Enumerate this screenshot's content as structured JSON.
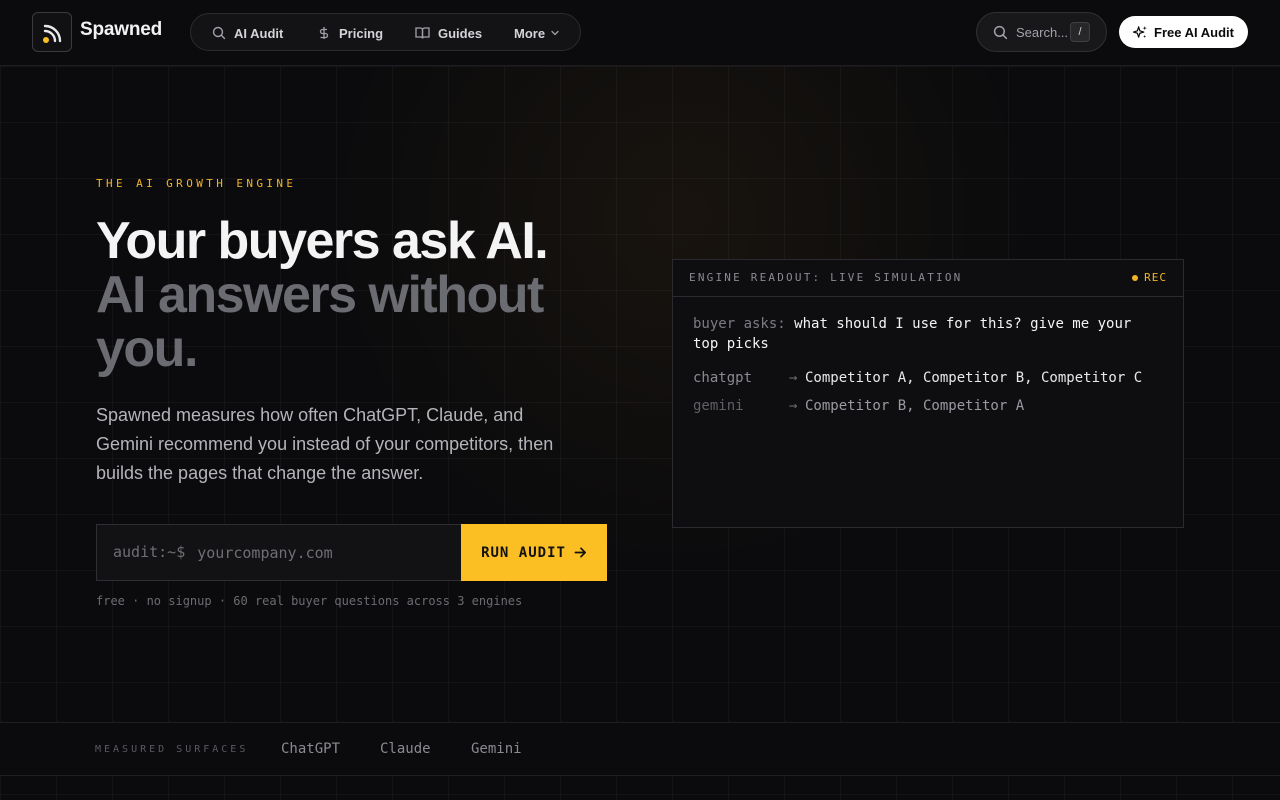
{
  "nav": {
    "brand": "Spawned",
    "items": [
      {
        "label": "AI Audit",
        "icon": "search-icon"
      },
      {
        "label": "Pricing",
        "icon": "dollar-icon"
      },
      {
        "label": "Guides",
        "icon": "book-icon"
      },
      {
        "label": "More",
        "icon": "chevron-down-icon"
      }
    ],
    "search_label": "Search...",
    "search_shortcut": "/",
    "cta_label": "Free AI Audit"
  },
  "hero": {
    "eyebrow": "THE AI GROWTH ENGINE",
    "headline_line1": "Your buyers ask AI.",
    "headline_line2": "AI answers without you.",
    "subcopy": "Spawned measures how often ChatGPT, Claude, and Gemini recommend you instead of your competitors, then builds the pages that change the answer.",
    "audit_prefix": "audit:~$",
    "audit_placeholder": "yourcompany.com",
    "run_label": "RUN AUDIT",
    "fineprint": "free · no signup · 60 real buyer questions across 3 engines"
  },
  "readout": {
    "title": "ENGINE READOUT: LIVE SIMULATION",
    "status": "REC",
    "question_label": "buyer asks:",
    "question": "what should I use for this? give me your top picks",
    "rows": [
      {
        "engine": "chatgpt",
        "arrow": "→",
        "answer": "Competitor A, Competitor B, Competitor C"
      },
      {
        "engine": "gemini",
        "arrow": "→",
        "answer": "Competitor B, Competitor A"
      }
    ]
  },
  "surfaces": {
    "label": "MEASURED SURFACES",
    "items": [
      "ChatGPT",
      "Claude",
      "Gemini"
    ]
  },
  "colors": {
    "accent": "#fbbf24",
    "background": "#0b0b0d"
  }
}
